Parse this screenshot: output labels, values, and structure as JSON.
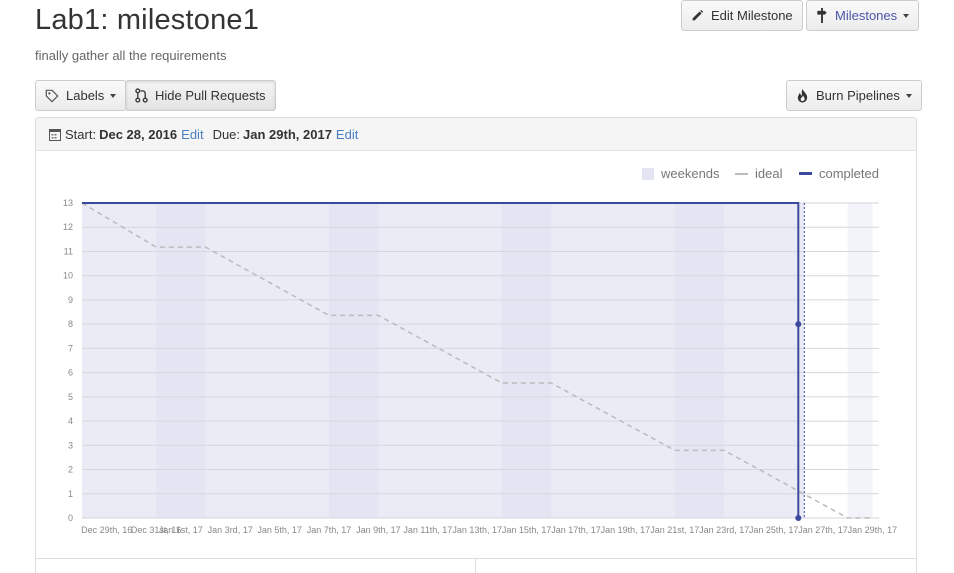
{
  "header": {
    "title": "Lab1: milestone1",
    "description": "finally gather all the requirements"
  },
  "toolbar": {
    "edit_milestone": "Edit Milestone",
    "milestones": "Milestones",
    "labels": "Labels",
    "hide_pull_requests": "Hide Pull Requests",
    "burn_pipelines": "Burn Pipelines"
  },
  "dates": {
    "start_label": "Start:",
    "start_value": "Dec 28, 2016",
    "start_edit": "Edit",
    "due_label": "Due:",
    "due_value": "Jan 29th, 2017",
    "due_edit": "Edit"
  },
  "legend": {
    "weekends": "weekends",
    "ideal": "ideal",
    "completed": "completed"
  },
  "icons": {
    "edit": "pencil-icon",
    "milestones": "milestone-icon",
    "labels": "tag-icon",
    "hide_pr": "git-pull-request-icon",
    "burn": "flame-icon",
    "calendar": "calendar-icon"
  },
  "colors": {
    "completed": "#3b4a9c",
    "ideal": "#bbbbbb",
    "weekend_band": "#e3e5f2",
    "plot_background": "#ebebf6",
    "link": "#4a7fc1"
  },
  "chart_data": {
    "type": "line",
    "ylim": [
      0,
      13
    ],
    "yticks": [
      0,
      1,
      2,
      3,
      4,
      5,
      6,
      7,
      8,
      9,
      10,
      11,
      12,
      13
    ],
    "xticks": [
      "Dec 29th, 16",
      "Dec 31st, 16",
      "Jan 1st, 17",
      "Jan 3rd, 17",
      "Jan 5th, 17",
      "Jan 7th, 17",
      "Jan 9th, 17",
      "Jan 11th, 17",
      "Jan 13th, 17",
      "Jan 15th, 17",
      "Jan 17th, 17",
      "Jan 19th, 17",
      "Jan 21st, 17",
      "Jan 23rd, 17",
      "Jan 25th, 17",
      "Jan 27th, 17",
      "Jan 29th, 17"
    ],
    "legend": "top-right",
    "grid": true,
    "weekends": [
      [
        "Dec 31st, 16",
        "Jan 2nd, 17"
      ],
      [
        "Jan 7th, 17",
        "Jan 9th, 17"
      ],
      [
        "Jan 14th, 17",
        "Jan 16th, 17"
      ],
      [
        "Jan 21st, 17",
        "Jan 23rd, 17"
      ],
      [
        "Jan 28th, 17",
        "Jan 29th, 17"
      ]
    ],
    "series": [
      {
        "name": "ideal",
        "points": [
          [
            "Dec 28th, 16",
            13
          ],
          [
            "Dec 31st, 16",
            11.18
          ],
          [
            "Jan 2nd, 17",
            11.18
          ],
          [
            "Jan 7th, 17",
            8.36
          ],
          [
            "Jan 9th, 17",
            8.36
          ],
          [
            "Jan 14th, 17",
            5.57
          ],
          [
            "Jan 16th, 17",
            5.57
          ],
          [
            "Jan 21st, 17",
            2.79
          ],
          [
            "Jan 23rd, 17",
            2.79
          ],
          [
            "Jan 28th, 17",
            0
          ],
          [
            "Jan 29th, 17",
            0
          ]
        ]
      },
      {
        "name": "completed",
        "points": [
          [
            "Dec 28th, 16",
            13
          ],
          [
            "Jan 26th, 17",
            13
          ],
          [
            "Jan 26th, 17",
            8
          ],
          [
            "Jan 26th, 17",
            0
          ]
        ]
      }
    ],
    "today": "Jan 26th, 17"
  }
}
